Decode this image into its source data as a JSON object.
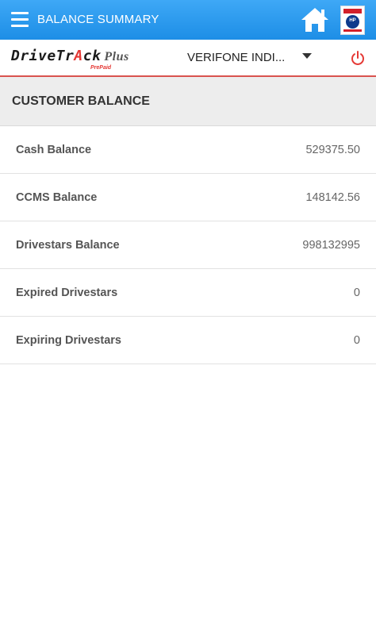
{
  "appbar": {
    "title": "BALANCE SUMMARY"
  },
  "subbar": {
    "logo_main": "DriveTr",
    "logo_accent": "A",
    "logo_end": "ck",
    "logo_plus": "Plus",
    "logo_sub": "PrePaid",
    "dealer_selected": "VERIFONE INDI..."
  },
  "section": {
    "title": "CUSTOMER BALANCE"
  },
  "balances": [
    {
      "label": "Cash Balance",
      "value": "529375.50"
    },
    {
      "label": "CCMS Balance",
      "value": "148142.56"
    },
    {
      "label": "Drivestars Balance",
      "value": "998132995"
    },
    {
      "label": "Expired Drivestars",
      "value": "0"
    },
    {
      "label": "Expiring Drivestars",
      "value": "0"
    }
  ],
  "colors": {
    "appbar": "#1d8ee6",
    "accent_red": "#e53935",
    "header_bg": "#ededed"
  },
  "icons": {
    "menu": "menu-icon",
    "home": "home-icon",
    "brand": "hp-logo-icon",
    "dropdown": "chevron-down-icon",
    "logout": "power-icon"
  }
}
